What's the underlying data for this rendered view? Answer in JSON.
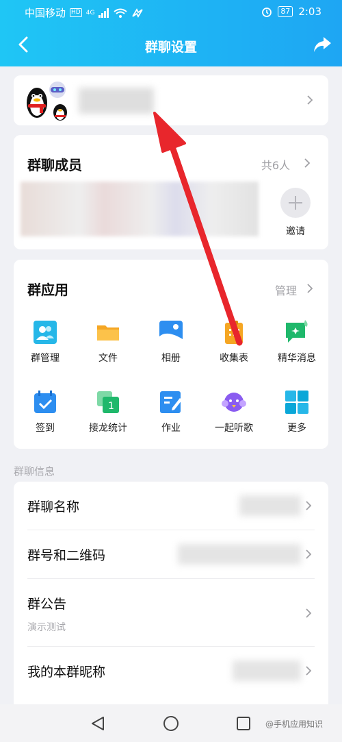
{
  "status_bar": {
    "carrier": "中国移动",
    "hd": "HD",
    "net": "4G",
    "battery": "87",
    "time": "2:03"
  },
  "nav": {
    "title": "群聊设置"
  },
  "members": {
    "title": "群聊成员",
    "count": "共6人",
    "invite_label": "邀请"
  },
  "apps_section": {
    "title": "群应用",
    "manage": "管理",
    "row1": [
      "群管理",
      "文件",
      "相册",
      "收集表",
      "精华消息"
    ],
    "row2": [
      "签到",
      "接龙统计",
      "作业",
      "一起听歌",
      "更多"
    ]
  },
  "info_section": {
    "label": "群聊信息",
    "name_label": "群聊名称",
    "qr_label": "群号和二维码",
    "notice_label": "群公告",
    "notice_value": "演示测试",
    "nickname_label": "我的本群昵称"
  },
  "watermark": "@手机应用知识",
  "colors": {
    "header_start": "#1fc6f5",
    "header_end": "#1ea6f3",
    "arrow": "#e8262c"
  }
}
